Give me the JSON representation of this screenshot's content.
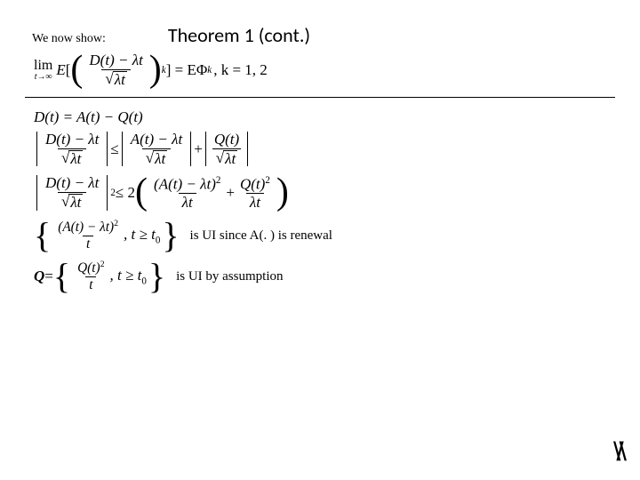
{
  "header": {
    "lead_in": "We now show:",
    "title": "Theorem 1 (cont.)"
  },
  "eq1": {
    "lim": "lim",
    "lim_under": "t→∞",
    "E": "E",
    "num": "D(t) − λt",
    "den_rad": "λt",
    "exp": "k",
    "rhs_eq": "] = E",
    "Phi": "Φ",
    "rhs_exp": "k",
    "kvals": ", k = 1, 2"
  },
  "eq2": {
    "text": "D(t) = A(t) − Q(t)"
  },
  "eq3": {
    "l_num": "D(t) − λt",
    "l_den_rad": "λt",
    "le": " ≤ ",
    "r1_num": "A(t) − λt",
    "r1_den_rad": "λt",
    "plus": " + ",
    "r2_num": "Q(t)",
    "r2_den_rad": "λt"
  },
  "eq4": {
    "l_num": "D(t) − λt",
    "l_den_rad": "λt",
    "l_exp": "2",
    "le": " ≤ 2",
    "r1_num_inner": "A(t) − λt",
    "r1_num_exp": "2",
    "r1_den": "λt",
    "plus": " + ",
    "r2_num": "Q(t)",
    "r2_num_exp": "2",
    "r2_den": "λt"
  },
  "eq5": {
    "inner_num_inner": "A(t) − λt",
    "inner_num_exp": "2",
    "inner_den": "t",
    "cond": ", t ≥ t",
    "cond_sub": "0",
    "note": "is UI since A(. ) is renewal"
  },
  "eq6": {
    "Q": "Q",
    "eqs": " = ",
    "inner_num": "Q(t)",
    "inner_num_exp": "2",
    "inner_den": "t",
    "cond": ", t ≥ t",
    "cond_sub": "0",
    "note": "is UI by assumption"
  },
  "logo": "\\/\\"
}
